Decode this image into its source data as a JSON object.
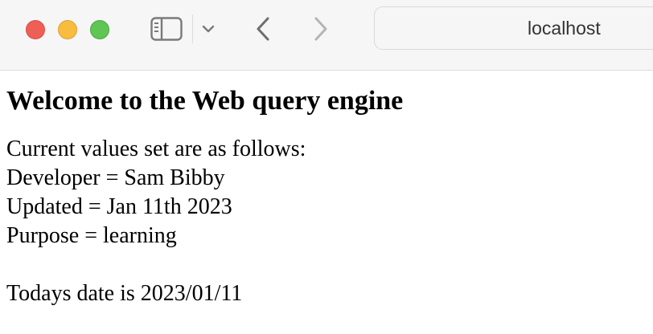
{
  "browser": {
    "address": "localhost"
  },
  "page": {
    "heading": "Welcome to the Web query engine",
    "intro": "Current values set are as follows:",
    "values": [
      "Developer = Sam Bibby",
      "Updated = Jan 11th 2023",
      "Purpose = learning"
    ],
    "date_line": "Todays date is 2023/01/11"
  },
  "icons": {
    "close": "traffic-light-close",
    "minimize": "traffic-light-minimize",
    "zoom": "traffic-light-zoom",
    "sidebar": "sidebar-icon",
    "chevron": "chevron-down-icon",
    "back": "chevron-left-icon",
    "forward": "chevron-right-icon"
  },
  "colors": {
    "close": "#ee5f58",
    "minimize": "#f8bd3f",
    "zoom": "#5fc553",
    "toolbar_bg": "#f6f6f7"
  }
}
